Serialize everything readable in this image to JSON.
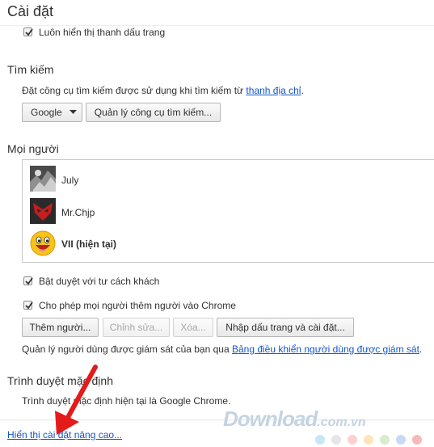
{
  "page": {
    "title": "Cài đặt",
    "faded_header": "..."
  },
  "appearance": {
    "bookmarks_bar_label": "Luôn hiển thị thanh dấu trang"
  },
  "search": {
    "title": "Tìm kiếm",
    "description": "Đặt công cụ tìm kiếm được sử dụng khi tìm kiếm từ",
    "omnibox_link": "thanh địa chỉ",
    "period": ".",
    "engine_selected": "Google",
    "manage_button": "Quản lý công cụ tìm kiếm..."
  },
  "people": {
    "title": "Mọi người",
    "users": [
      {
        "name": "July",
        "avatar_icon": "dark-photo-avatar-icon"
      },
      {
        "name": "Mr.Chjp",
        "avatar_icon": "red-mask-avatar-icon"
      },
      {
        "name": "VII (hiện tại)",
        "avatar_icon": "smiley-avatar-icon",
        "current": true
      }
    ],
    "guest_label": "Bật duyệt với tư cách khách",
    "add_people_label": "Cho phép mọi người thêm người vào Chrome",
    "buttons": {
      "add": "Thêm người...",
      "edit": "Chỉnh sửa...",
      "delete": "Xóa...",
      "import": "Nhập dấu trang và cài đặt..."
    },
    "supervised_text": "Quản lý người dùng được giám sát của bạn qua",
    "supervised_link": "Bảng điều khiển người dùng được giám sát",
    "period": "."
  },
  "default_browser": {
    "title": "Trình duyệt mặc định",
    "status": "Trình duyệt mặc định hiện tại là Google Chrome."
  },
  "advanced_link": "Hiển thị cài đặt nâng cao...",
  "watermark": {
    "brand": "Download",
    "domain": ".com.vn"
  },
  "colors": {
    "link": "#1155cc",
    "arrow": "#e31b1b",
    "dots": [
      "#c9e6f7",
      "#e6e6e6",
      "#fbd0d0",
      "#fde5b8",
      "#d8ecd0",
      "#c9d9f3",
      "#f7b9b9"
    ]
  }
}
